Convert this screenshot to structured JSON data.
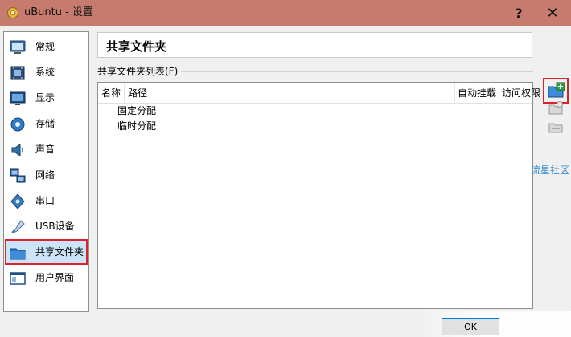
{
  "window": {
    "title": "uBuntu - 设置",
    "help_label": "?",
    "close_label": "✕"
  },
  "sidebar": {
    "items": [
      {
        "label": "常规",
        "icon": "general-icon"
      },
      {
        "label": "系统",
        "icon": "system-icon"
      },
      {
        "label": "显示",
        "icon": "display-icon"
      },
      {
        "label": "存储",
        "icon": "storage-icon"
      },
      {
        "label": "声音",
        "icon": "audio-icon"
      },
      {
        "label": "网络",
        "icon": "network-icon"
      },
      {
        "label": "串口",
        "icon": "serial-port-icon"
      },
      {
        "label": "USB设备",
        "icon": "usb-icon"
      },
      {
        "label": "共享文件夹",
        "icon": "shared-folder-icon",
        "selected": true
      },
      {
        "label": "用户界面",
        "icon": "user-interface-icon"
      }
    ]
  },
  "main": {
    "page_title": "共享文件夹",
    "list_label": "共享文件夹列表(F)",
    "columns": [
      "名称",
      "路径",
      "自动挂载",
      "访问权限"
    ],
    "rows": [
      "固定分配",
      "临时分配"
    ]
  },
  "toolbar": {
    "add": "add-shared-folder-icon",
    "edit": "edit-shared-folder-icon",
    "remove": "remove-shared-folder-icon"
  },
  "watermark": "流星社区",
  "footer": {
    "ok_label": "OK"
  },
  "colors": {
    "titlebar": "#c77b6e",
    "highlight": "#e0202a",
    "selection": "#cce4f7"
  }
}
